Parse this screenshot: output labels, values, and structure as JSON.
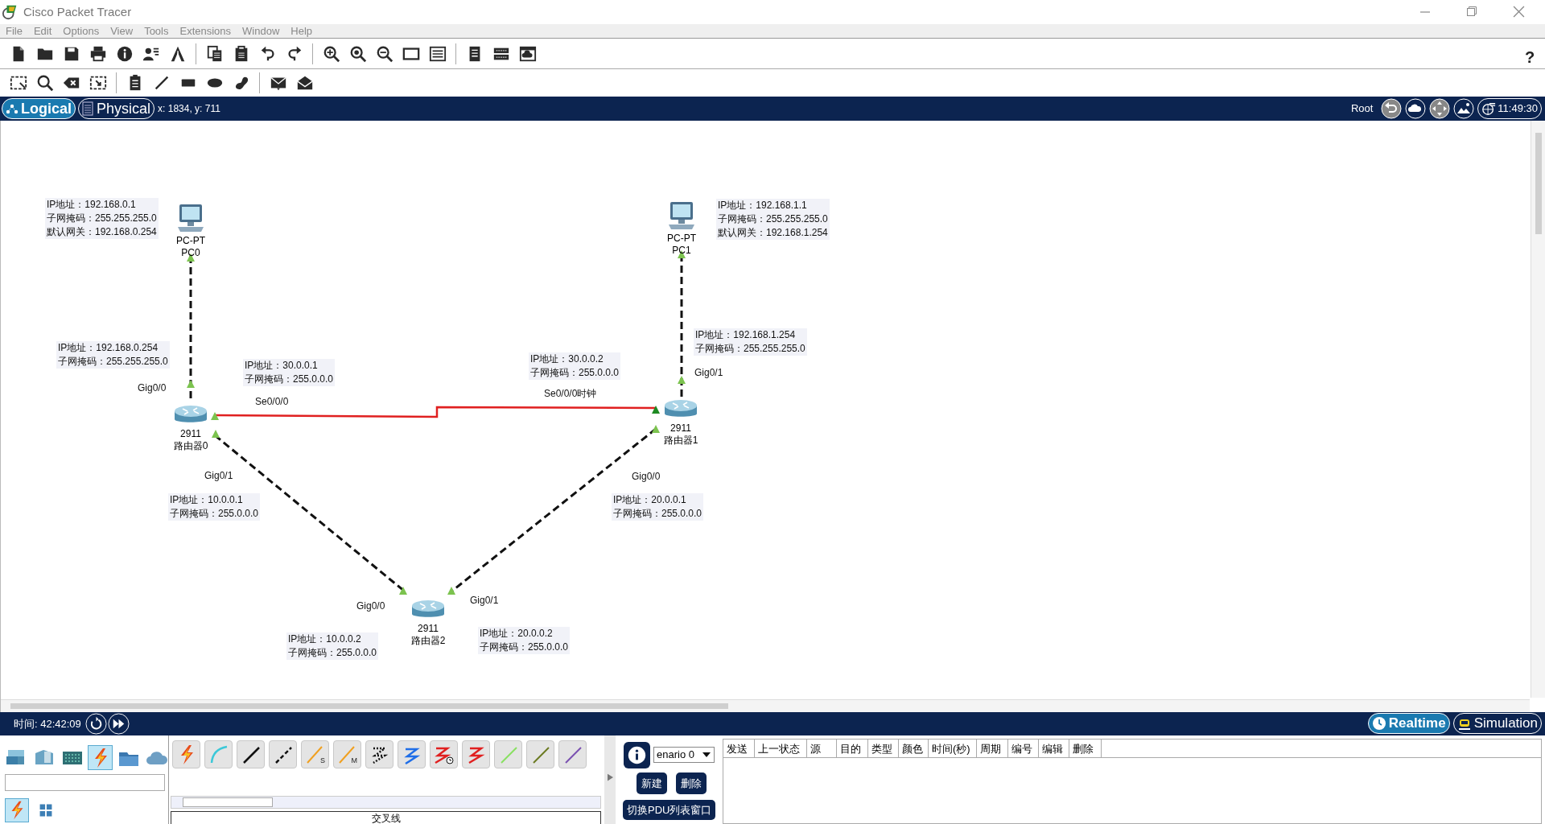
{
  "window": {
    "title": "Cisco Packet Tracer"
  },
  "help": "?",
  "menu": [
    "File",
    "Edit",
    "Options",
    "View",
    "Tools",
    "Extensions",
    "Window",
    "Help"
  ],
  "workspace_bar": {
    "tabs": [
      {
        "label": "Logical",
        "selected": true
      },
      {
        "label": "Physical",
        "selected": false
      }
    ],
    "coords": "x: 1834, y: 711",
    "root": "Root",
    "clock": "11:49:30"
  },
  "topology": {
    "devices": [
      {
        "kind": "pc",
        "model": "PC-PT",
        "name": "PC0"
      },
      {
        "kind": "pc",
        "model": "PC-PT",
        "name": "PC1"
      },
      {
        "kind": "router",
        "model": "2911",
        "name": "路由器0"
      },
      {
        "kind": "router",
        "model": "2911",
        "name": "路由器1"
      },
      {
        "kind": "router",
        "model": "2911",
        "name": "路由器2"
      }
    ],
    "links": [
      {
        "kind": "ethernet",
        "ends": [
          {
            "color": "#7cc34f"
          },
          {
            "color": "#7cc34f"
          }
        ]
      },
      {
        "kind": "ethernet",
        "ends": [
          {
            "color": "#7cc34f"
          },
          {
            "color": "#7cc34f"
          }
        ]
      },
      {
        "kind": "serial",
        "ends": [
          {
            "color": "#7cc34f"
          },
          {
            "color": "#1e8a22"
          }
        ]
      },
      {
        "kind": "ethernet",
        "ends": [
          {
            "color": "#7cc34f"
          },
          {
            "color": "#7cc34f"
          }
        ]
      },
      {
        "kind": "ethernet",
        "ends": [
          {
            "color": "#7cc34f"
          },
          {
            "color": "#7cc34f"
          }
        ]
      }
    ],
    "labels": [
      {
        "kind": "note",
        "lines": [
          "IP地址：192.168.0.1",
          "子网掩码：255.255.255.0",
          "默认网关：192.168.0.254"
        ]
      },
      {
        "kind": "note",
        "lines": [
          "IP地址：192.168.1.1",
          "子网掩码：255.255.255.0",
          "默认网关：192.168.1.254"
        ]
      },
      {
        "kind": "note",
        "lines": [
          "IP地址：192.168.1.254",
          "子网掩码：255.255.255.0"
        ]
      },
      {
        "kind": "note",
        "lines": [
          "IP地址：192.168.0.254",
          "子网掩码：255.255.255.0"
        ]
      },
      {
        "kind": "note",
        "lines": [
          "IP地址：30.0.0.2",
          "子网掩码：255.0.0.0"
        ]
      },
      {
        "kind": "note",
        "lines": [
          "IP地址：30.0.0.1",
          "子网掩码：255.0.0.0"
        ]
      },
      {
        "kind": "port",
        "lines": [
          "Gig0/1"
        ]
      },
      {
        "kind": "port",
        "lines": [
          "Gig0/0"
        ]
      },
      {
        "kind": "port",
        "lines": [
          "Se0/0/0时钟"
        ]
      },
      {
        "kind": "port",
        "lines": [
          "Se0/0/0"
        ]
      },
      {
        "kind": "port",
        "lines": [
          "Gig0/1"
        ]
      },
      {
        "kind": "port",
        "lines": [
          "Gig0/0"
        ]
      },
      {
        "kind": "note",
        "lines": [
          "IP地址：10.0.0.1",
          "子网掩码：255.0.0.0"
        ]
      },
      {
        "kind": "note",
        "lines": [
          "IP地址：20.0.0.1",
          "子网掩码：255.0.0.0"
        ]
      },
      {
        "kind": "port",
        "lines": [
          "Gig0/1"
        ]
      },
      {
        "kind": "port",
        "lines": [
          "Gig0/0"
        ]
      },
      {
        "kind": "note",
        "lines": [
          "IP地址：20.0.0.2",
          "子网掩码：255.0.0.0"
        ]
      },
      {
        "kind": "note",
        "lines": [
          "IP地址：10.0.0.2",
          "子网掩码：255.0.0.0"
        ]
      }
    ]
  },
  "time_bar": {
    "time": "时间: 42:42:09",
    "modes": [
      {
        "label": "Realtime",
        "selected": true
      },
      {
        "label": "Simulation",
        "selected": false
      }
    ]
  },
  "device_categories": [
    {
      "kind": "routers",
      "selected": false
    },
    {
      "kind": "switches",
      "selected": false
    },
    {
      "kind": "hubs",
      "selected": false
    },
    {
      "kind": "connections",
      "selected": true
    },
    {
      "kind": "office",
      "selected": false
    },
    {
      "kind": "cloud",
      "selected": false
    }
  ],
  "subcategories": [
    {
      "kind": "connections",
      "selected": true
    },
    {
      "kind": "grid",
      "selected": false
    }
  ],
  "connection_types": [
    {
      "kind": "auto"
    },
    {
      "kind": "console"
    },
    {
      "kind": "straight"
    },
    {
      "kind": "cross"
    },
    {
      "kind": "fiber",
      "letter": "S"
    },
    {
      "kind": "fiber",
      "letter": "M"
    },
    {
      "kind": "phone"
    },
    {
      "kind": "coaxial"
    },
    {
      "kind": "serial-dce"
    },
    {
      "kind": "serial-dte"
    },
    {
      "kind": "octal"
    },
    {
      "kind": "iot"
    },
    {
      "kind": "usb"
    }
  ],
  "connection_caption": "交叉线",
  "pdu_panel": {
    "scenario": "enario 0",
    "buttons": [
      "新建",
      "删除"
    ],
    "toggle": "切换PDU列表窗口",
    "columns": [
      "发送",
      "上一状态",
      "源",
      "目的",
      "类型",
      "颜色",
      "时间(秒)",
      "周期",
      "编号",
      "编辑",
      "删除"
    ]
  }
}
